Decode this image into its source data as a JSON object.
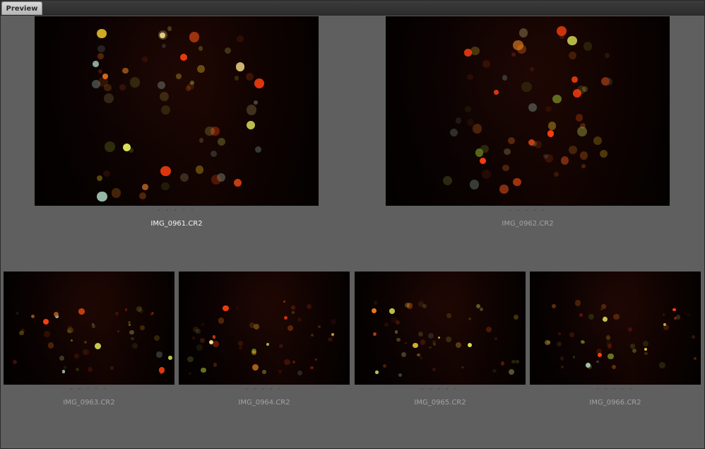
{
  "panel": {
    "tab_label": "Preview"
  },
  "thumbnails": [
    {
      "filename": "IMG_0961.CR2",
      "rating": "· · · · ·",
      "selected": true
    },
    {
      "filename": "IMG_0962.CR2",
      "rating": "· · · · ·",
      "selected": false
    },
    {
      "filename": "IMG_0963.CR2",
      "rating": "· · · · ·",
      "selected": false
    },
    {
      "filename": "IMG_0964.CR2",
      "rating": "· · · · ·",
      "selected": false
    },
    {
      "filename": "IMG_0965.CR2",
      "rating": "· · · · ·",
      "selected": false
    },
    {
      "filename": "IMG_0966.CR2",
      "rating": "· · · · ·",
      "selected": false
    }
  ]
}
